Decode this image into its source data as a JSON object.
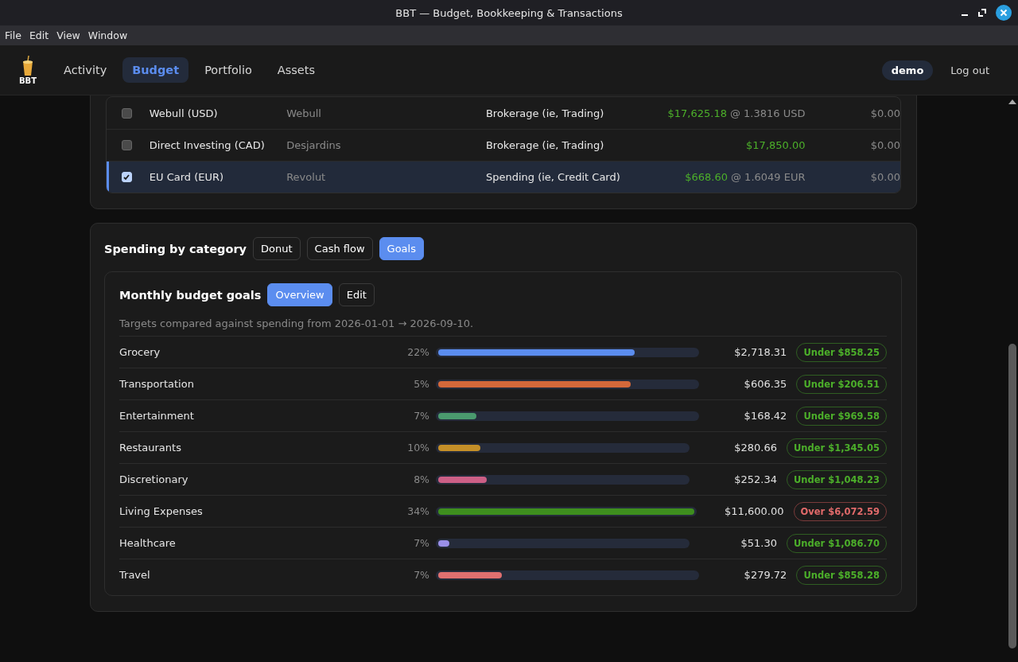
{
  "window": {
    "title": "BBT — Budget, Bookkeeping & Transactions"
  },
  "menu": [
    "File",
    "Edit",
    "View",
    "Window"
  ],
  "app_header": {
    "logo_text": "BBT",
    "nav": [
      {
        "label": "Activity",
        "selected": false
      },
      {
        "label": "Budget",
        "selected": true
      },
      {
        "label": "Portfolio",
        "selected": false
      },
      {
        "label": "Assets",
        "selected": false
      }
    ],
    "user": "demo",
    "logout": "Log out"
  },
  "accounts": [
    {
      "checked": false,
      "name": "Webull (USD)",
      "institution": "Webull",
      "type": "Brokerage (ie, Trading)",
      "balance": "$17,625.18",
      "rate": "@ 1.3816 USD",
      "column_6": "$0.00"
    },
    {
      "checked": false,
      "name": "Direct Investing (CAD)",
      "institution": "Desjardins",
      "type": "Brokerage (ie, Trading)",
      "balance": "$17,850.00",
      "column_6": "$0.00"
    },
    {
      "checked": true,
      "name": "EU Card (EUR)",
      "institution": "Revolut",
      "type": "Spending (ie, Credit Card)",
      "balance": "$668.60",
      "rate": "@ 1.6049 EUR",
      "column_6": "$0.00"
    }
  ],
  "spending": {
    "title": "Spending by category",
    "views": [
      {
        "label": "Donut",
        "selected": false
      },
      {
        "label": "Cash flow",
        "selected": false
      },
      {
        "label": "Goals",
        "selected": true
      }
    ],
    "goals": {
      "title": "Monthly budget goals",
      "modes": [
        {
          "label": "Overview",
          "selected": true
        },
        {
          "label": "Edit",
          "selected": false
        }
      ],
      "note": "Targets compared against spending from 2026-01-01 → 2026-09-10.",
      "rows": [
        {
          "category": "Grocery",
          "share": "22%",
          "level": 0.76,
          "color": "#5b8def",
          "amount": "$2,718.31",
          "status": "Under $858.25",
          "kind": "under"
        },
        {
          "category": "Transportation",
          "share": "5%",
          "level": 0.745,
          "color": "#d4683a",
          "amount": "$606.35",
          "status": "Under $206.51",
          "kind": "under"
        },
        {
          "category": "Entertainment",
          "share": "7%",
          "level": 0.146,
          "color": "#4a9a6e",
          "amount": "$168.42",
          "status": "Under $969.58",
          "kind": "under"
        },
        {
          "category": "Restaurants",
          "share": "10%",
          "level": 0.17,
          "color": "#c48f28",
          "amount": "$280.66",
          "status": "Under $1,345.05",
          "kind": "under"
        },
        {
          "category": "Discretionary",
          "share": "8%",
          "level": 0.195,
          "color": "#cc5f86",
          "amount": "$252.34",
          "status": "Under $1,048.23",
          "kind": "under"
        },
        {
          "category": "Living Expenses",
          "share": "34%",
          "level": 1.0,
          "color": "#3e8e1e",
          "amount": "$11,600.00",
          "status": "Over $6,072.59",
          "kind": "over"
        },
        {
          "category": "Healthcare",
          "share": "7%",
          "level": 0.045,
          "color": "#9a8fe8",
          "amount": "$51.30",
          "status": "Under $1,086.70",
          "kind": "under"
        },
        {
          "category": "Travel",
          "share": "7%",
          "level": 0.245,
          "color": "#e07070",
          "amount": "$279.72",
          "status": "Under $858.28",
          "kind": "under"
        }
      ]
    }
  }
}
